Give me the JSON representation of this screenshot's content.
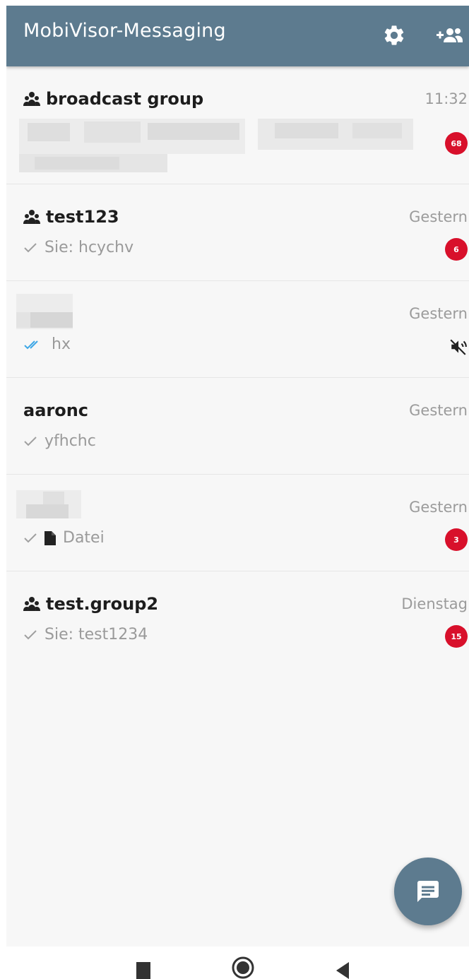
{
  "appbar": {
    "title": "MobiVisor-Messaging",
    "color": "#5d7b8f",
    "icons": [
      "gear-icon",
      "add-group-icon"
    ]
  },
  "chats": [
    {
      "name": "broadcast group",
      "is_group": true,
      "time": "11:32",
      "preview": "",
      "preview_redacted": true,
      "badge": "68"
    },
    {
      "name": "test123",
      "is_group": true,
      "time": "Gestern",
      "preview": "Sie: hcychv",
      "status": "sent",
      "badge": "6"
    },
    {
      "name": "",
      "name_redacted": true,
      "time": "Gestern",
      "preview": "hx",
      "status": "read",
      "muted": true
    },
    {
      "name": "aaronc",
      "is_group": false,
      "time": "Gestern",
      "preview": "yfhchc",
      "status": "sent"
    },
    {
      "name": "",
      "name_redacted": true,
      "time": "Gestern",
      "preview": "Datei",
      "status": "sent",
      "attachment": "file-icon",
      "badge": "3"
    },
    {
      "name": "test.group2",
      "is_group": true,
      "time": "Dienstag",
      "preview": "Sie: test1234",
      "status": "sent",
      "badge": "15"
    }
  ],
  "fab": {
    "icon": "chat-icon"
  },
  "colors": {
    "accent": "#5d7b8f",
    "badge": "#d8102b",
    "read_tick": "#3ea7e6"
  }
}
